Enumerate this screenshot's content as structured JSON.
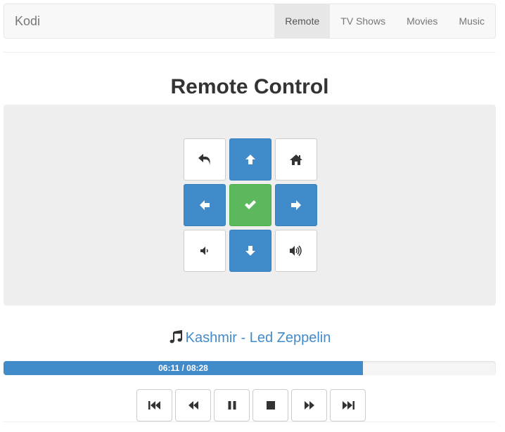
{
  "navbar": {
    "brand": "Kodi",
    "items": [
      {
        "label": "Remote",
        "active": true
      },
      {
        "label": "TV Shows",
        "active": false
      },
      {
        "label": "Movies",
        "active": false
      },
      {
        "label": "Music",
        "active": false
      }
    ]
  },
  "page": {
    "title": "Remote Control"
  },
  "remote": {
    "buttons": [
      {
        "icon": "back-icon"
      },
      {
        "icon": "arrow-up-icon"
      },
      {
        "icon": "home-icon"
      },
      {
        "icon": "arrow-left-icon"
      },
      {
        "icon": "check-icon"
      },
      {
        "icon": "arrow-right-icon"
      },
      {
        "icon": "volume-down-icon"
      },
      {
        "icon": "arrow-down-icon"
      },
      {
        "icon": "volume-up-icon"
      }
    ]
  },
  "now_playing": {
    "icon": "music-note-icon",
    "title": "Kashmir - Led Zeppelin",
    "progress_text": "06:11 / 08:28",
    "progress_fraction": 0.73
  },
  "transport": {
    "buttons": [
      {
        "icon": "skip-previous-icon"
      },
      {
        "icon": "rewind-icon"
      },
      {
        "icon": "pause-icon"
      },
      {
        "icon": "stop-icon"
      },
      {
        "icon": "fast-forward-icon"
      },
      {
        "icon": "skip-next-icon"
      }
    ]
  },
  "colors": {
    "primary": "#428bca",
    "success": "#5cb85c",
    "well": "#eeeeee",
    "icon_dark": "#333333"
  }
}
